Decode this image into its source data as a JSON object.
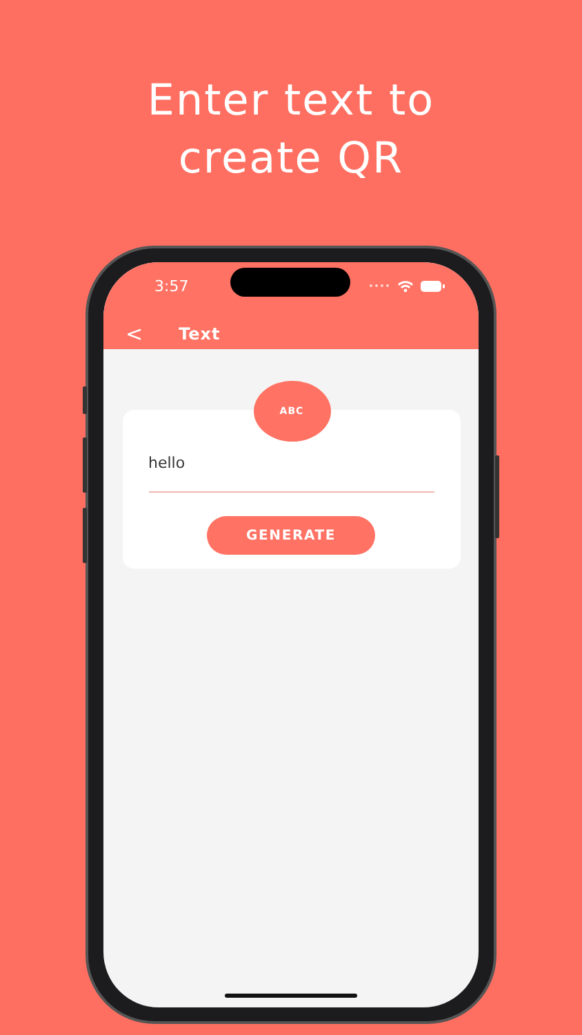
{
  "headline": "Enter text to create QR",
  "status_bar": {
    "time": "3:57"
  },
  "nav": {
    "back": "<",
    "title": "Text"
  },
  "badge": "ABC",
  "input": {
    "value": "hello"
  },
  "button": "GENERATE"
}
